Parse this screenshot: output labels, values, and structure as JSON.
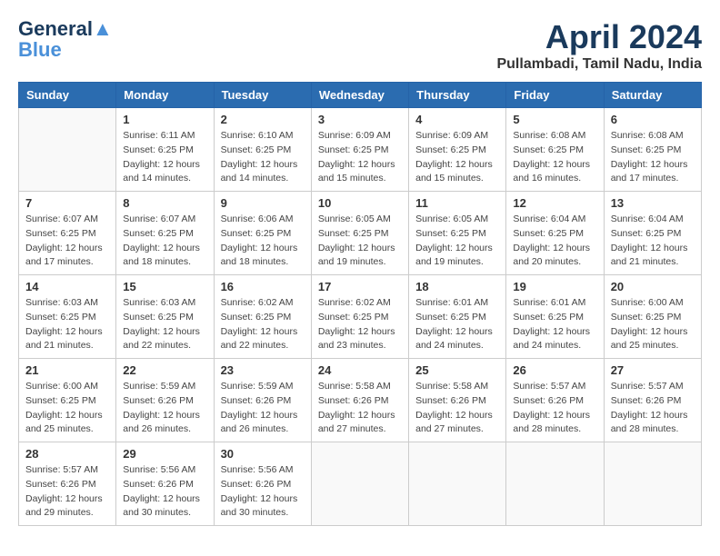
{
  "header": {
    "logo_line1": "General",
    "logo_line2": "Blue",
    "month_title": "April 2024",
    "location": "Pullambadi, Tamil Nadu, India"
  },
  "weekdays": [
    "Sunday",
    "Monday",
    "Tuesday",
    "Wednesday",
    "Thursday",
    "Friday",
    "Saturday"
  ],
  "weeks": [
    [
      {
        "day": "",
        "sunrise": "",
        "sunset": "",
        "daylight": ""
      },
      {
        "day": "1",
        "sunrise": "Sunrise: 6:11 AM",
        "sunset": "Sunset: 6:25 PM",
        "daylight": "Daylight: 12 hours and 14 minutes."
      },
      {
        "day": "2",
        "sunrise": "Sunrise: 6:10 AM",
        "sunset": "Sunset: 6:25 PM",
        "daylight": "Daylight: 12 hours and 14 minutes."
      },
      {
        "day": "3",
        "sunrise": "Sunrise: 6:09 AM",
        "sunset": "Sunset: 6:25 PM",
        "daylight": "Daylight: 12 hours and 15 minutes."
      },
      {
        "day": "4",
        "sunrise": "Sunrise: 6:09 AM",
        "sunset": "Sunset: 6:25 PM",
        "daylight": "Daylight: 12 hours and 15 minutes."
      },
      {
        "day": "5",
        "sunrise": "Sunrise: 6:08 AM",
        "sunset": "Sunset: 6:25 PM",
        "daylight": "Daylight: 12 hours and 16 minutes."
      },
      {
        "day": "6",
        "sunrise": "Sunrise: 6:08 AM",
        "sunset": "Sunset: 6:25 PM",
        "daylight": "Daylight: 12 hours and 17 minutes."
      }
    ],
    [
      {
        "day": "7",
        "sunrise": "Sunrise: 6:07 AM",
        "sunset": "Sunset: 6:25 PM",
        "daylight": "Daylight: 12 hours and 17 minutes."
      },
      {
        "day": "8",
        "sunrise": "Sunrise: 6:07 AM",
        "sunset": "Sunset: 6:25 PM",
        "daylight": "Daylight: 12 hours and 18 minutes."
      },
      {
        "day": "9",
        "sunrise": "Sunrise: 6:06 AM",
        "sunset": "Sunset: 6:25 PM",
        "daylight": "Daylight: 12 hours and 18 minutes."
      },
      {
        "day": "10",
        "sunrise": "Sunrise: 6:05 AM",
        "sunset": "Sunset: 6:25 PM",
        "daylight": "Daylight: 12 hours and 19 minutes."
      },
      {
        "day": "11",
        "sunrise": "Sunrise: 6:05 AM",
        "sunset": "Sunset: 6:25 PM",
        "daylight": "Daylight: 12 hours and 19 minutes."
      },
      {
        "day": "12",
        "sunrise": "Sunrise: 6:04 AM",
        "sunset": "Sunset: 6:25 PM",
        "daylight": "Daylight: 12 hours and 20 minutes."
      },
      {
        "day": "13",
        "sunrise": "Sunrise: 6:04 AM",
        "sunset": "Sunset: 6:25 PM",
        "daylight": "Daylight: 12 hours and 21 minutes."
      }
    ],
    [
      {
        "day": "14",
        "sunrise": "Sunrise: 6:03 AM",
        "sunset": "Sunset: 6:25 PM",
        "daylight": "Daylight: 12 hours and 21 minutes."
      },
      {
        "day": "15",
        "sunrise": "Sunrise: 6:03 AM",
        "sunset": "Sunset: 6:25 PM",
        "daylight": "Daylight: 12 hours and 22 minutes."
      },
      {
        "day": "16",
        "sunrise": "Sunrise: 6:02 AM",
        "sunset": "Sunset: 6:25 PM",
        "daylight": "Daylight: 12 hours and 22 minutes."
      },
      {
        "day": "17",
        "sunrise": "Sunrise: 6:02 AM",
        "sunset": "Sunset: 6:25 PM",
        "daylight": "Daylight: 12 hours and 23 minutes."
      },
      {
        "day": "18",
        "sunrise": "Sunrise: 6:01 AM",
        "sunset": "Sunset: 6:25 PM",
        "daylight": "Daylight: 12 hours and 24 minutes."
      },
      {
        "day": "19",
        "sunrise": "Sunrise: 6:01 AM",
        "sunset": "Sunset: 6:25 PM",
        "daylight": "Daylight: 12 hours and 24 minutes."
      },
      {
        "day": "20",
        "sunrise": "Sunrise: 6:00 AM",
        "sunset": "Sunset: 6:25 PM",
        "daylight": "Daylight: 12 hours and 25 minutes."
      }
    ],
    [
      {
        "day": "21",
        "sunrise": "Sunrise: 6:00 AM",
        "sunset": "Sunset: 6:25 PM",
        "daylight": "Daylight: 12 hours and 25 minutes."
      },
      {
        "day": "22",
        "sunrise": "Sunrise: 5:59 AM",
        "sunset": "Sunset: 6:26 PM",
        "daylight": "Daylight: 12 hours and 26 minutes."
      },
      {
        "day": "23",
        "sunrise": "Sunrise: 5:59 AM",
        "sunset": "Sunset: 6:26 PM",
        "daylight": "Daylight: 12 hours and 26 minutes."
      },
      {
        "day": "24",
        "sunrise": "Sunrise: 5:58 AM",
        "sunset": "Sunset: 6:26 PM",
        "daylight": "Daylight: 12 hours and 27 minutes."
      },
      {
        "day": "25",
        "sunrise": "Sunrise: 5:58 AM",
        "sunset": "Sunset: 6:26 PM",
        "daylight": "Daylight: 12 hours and 27 minutes."
      },
      {
        "day": "26",
        "sunrise": "Sunrise: 5:57 AM",
        "sunset": "Sunset: 6:26 PM",
        "daylight": "Daylight: 12 hours and 28 minutes."
      },
      {
        "day": "27",
        "sunrise": "Sunrise: 5:57 AM",
        "sunset": "Sunset: 6:26 PM",
        "daylight": "Daylight: 12 hours and 28 minutes."
      }
    ],
    [
      {
        "day": "28",
        "sunrise": "Sunrise: 5:57 AM",
        "sunset": "Sunset: 6:26 PM",
        "daylight": "Daylight: 12 hours and 29 minutes."
      },
      {
        "day": "29",
        "sunrise": "Sunrise: 5:56 AM",
        "sunset": "Sunset: 6:26 PM",
        "daylight": "Daylight: 12 hours and 30 minutes."
      },
      {
        "day": "30",
        "sunrise": "Sunrise: 5:56 AM",
        "sunset": "Sunset: 6:26 PM",
        "daylight": "Daylight: 12 hours and 30 minutes."
      },
      {
        "day": "",
        "sunrise": "",
        "sunset": "",
        "daylight": ""
      },
      {
        "day": "",
        "sunrise": "",
        "sunset": "",
        "daylight": ""
      },
      {
        "day": "",
        "sunrise": "",
        "sunset": "",
        "daylight": ""
      },
      {
        "day": "",
        "sunrise": "",
        "sunset": "",
        "daylight": ""
      }
    ]
  ]
}
